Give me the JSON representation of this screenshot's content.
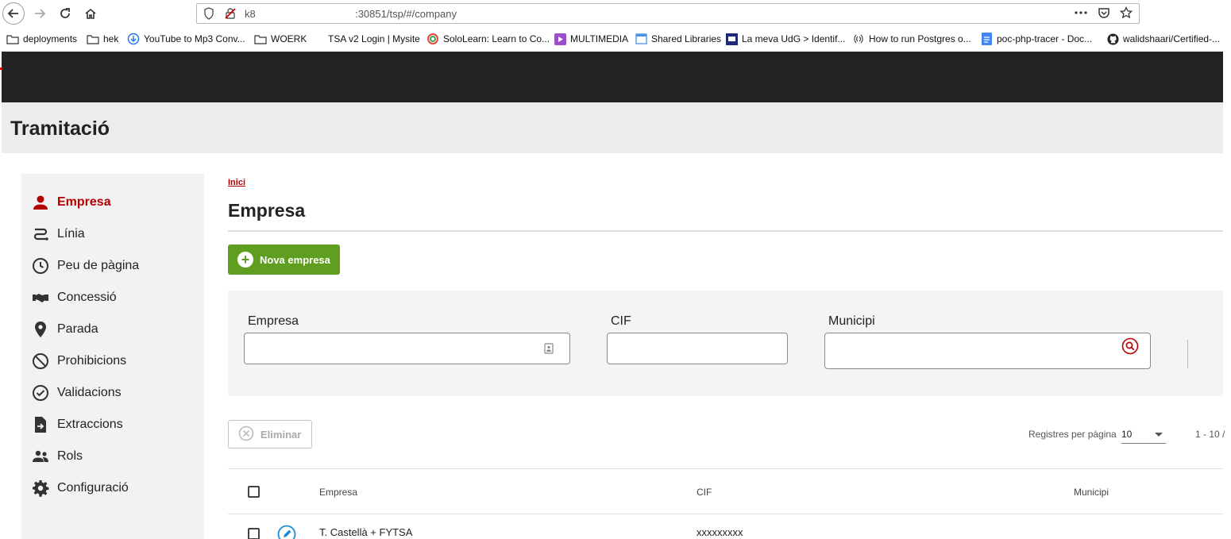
{
  "browser": {
    "url_prefix": "k8",
    "url_suffix": " :30851/tsp/#/company",
    "bookmarks": [
      {
        "label": "deployments",
        "icon": "folder-icon"
      },
      {
        "label": "hek",
        "icon": "folder-icon"
      },
      {
        "label": "YouTube to Mp3 Conv...",
        "icon": "download-icon"
      },
      {
        "label": "WOERK",
        "icon": "folder-icon"
      },
      {
        "label": "TSA v2 Login | Mysite",
        "icon": "none"
      },
      {
        "label": "SoloLearn: Learn to Co...",
        "icon": "sololearn-icon"
      },
      {
        "label": "MULTIMEDIA",
        "icon": "multimedia-icon"
      },
      {
        "label": "Shared Libraries",
        "icon": "page-icon"
      },
      {
        "label": "La meva UdG > Identif...",
        "icon": "udg-icon"
      },
      {
        "label": "How to run Postgres o...",
        "icon": "signal-icon"
      },
      {
        "label": "poc-php-tracer - Doc...",
        "icon": "doc-icon"
      },
      {
        "label": "walidshaari/Certified-...",
        "icon": "github-icon"
      }
    ]
  },
  "app": {
    "title": "Tramitació"
  },
  "sidebar": {
    "items": [
      {
        "label": "Empresa",
        "icon": "person-icon",
        "active": true
      },
      {
        "label": "Línia",
        "icon": "route-icon"
      },
      {
        "label": "Peu de pàgina",
        "icon": "clock-icon"
      },
      {
        "label": "Concessió",
        "icon": "handshake-icon"
      },
      {
        "label": "Parada",
        "icon": "location-pin-icon"
      },
      {
        "label": "Prohibicions",
        "icon": "block-icon"
      },
      {
        "label": "Validacions",
        "icon": "check-circle-icon"
      },
      {
        "label": "Extraccions",
        "icon": "file-export-icon"
      },
      {
        "label": "Rols",
        "icon": "people-icon"
      },
      {
        "label": "Configuració",
        "icon": "gear-icon"
      }
    ]
  },
  "main": {
    "breadcrumb": "Inici",
    "title": "Empresa",
    "new_button": "Nova empresa",
    "filters": {
      "empresa_label": "Empresa",
      "cif_label": "CIF",
      "municipi_label": "Municipi"
    },
    "delete_button": "Eliminar",
    "pager": {
      "label": "Registres per pàgina",
      "value": "10",
      "range": "1 - 10 /"
    },
    "table": {
      "columns": [
        "Empresa",
        "CIF",
        "Municipi"
      ],
      "rows": [
        {
          "empresa": "T. Castellà + FYTSA",
          "cif": "xxxxxxxxx",
          "municipi": ""
        }
      ]
    }
  },
  "colors": {
    "accent_red": "#b50000",
    "new_button_green": "#5f9e1f",
    "header_black": "#232323"
  }
}
